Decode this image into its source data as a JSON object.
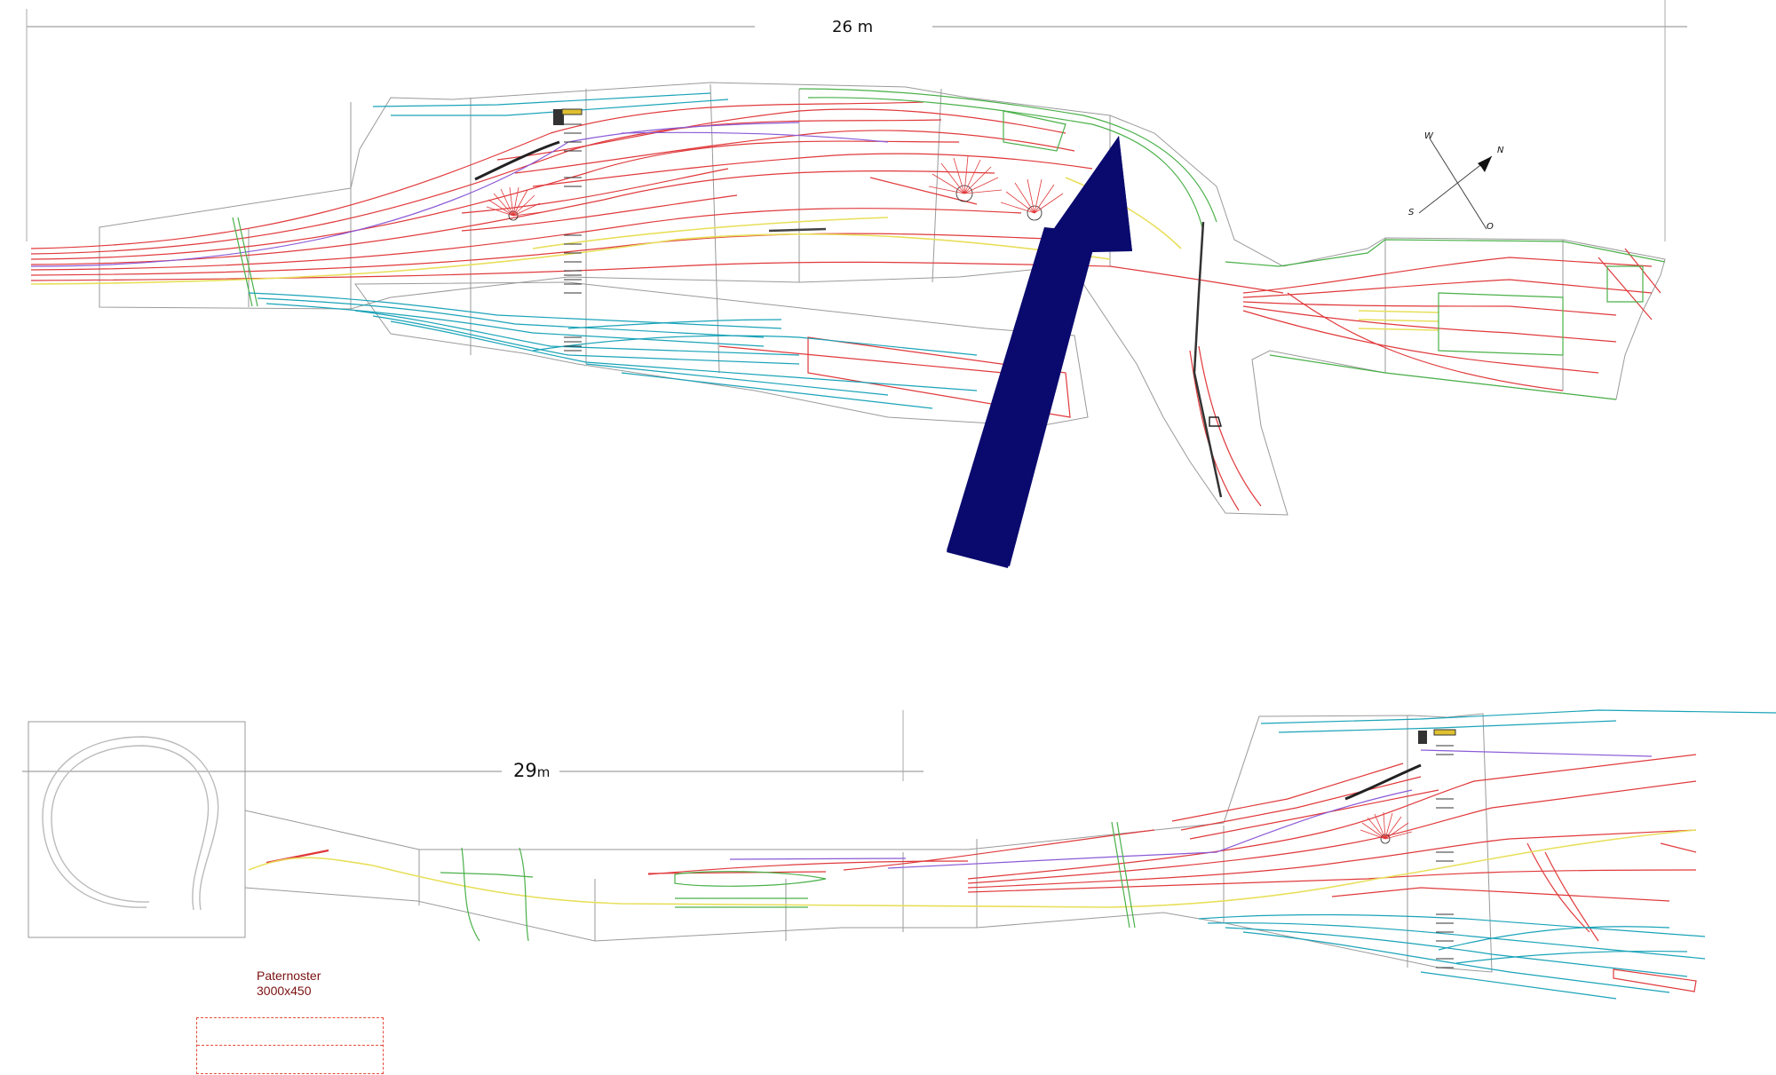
{
  "plan_top": {
    "dimension_label_value": "26",
    "dimension_label_unit": "m"
  },
  "plan_bottom": {
    "dimension_label_value": "29",
    "dimension_label_unit": "m"
  },
  "compass": {
    "labels": [
      "W",
      "N",
      "S",
      "O"
    ]
  },
  "pointer_arrow": {
    "color": "#0a0a6e"
  },
  "paternoster": {
    "title": "Paternoster",
    "size": "3000x450"
  },
  "colors": {
    "tracks_main": "#e0393b",
    "tracks_yard": "#1aa3b8",
    "tracks_green": "#4ab04a",
    "tracks_yellow": "#e8df5a",
    "tracks_purple": "#8a5ad6",
    "outline": "#9a9a9a"
  }
}
